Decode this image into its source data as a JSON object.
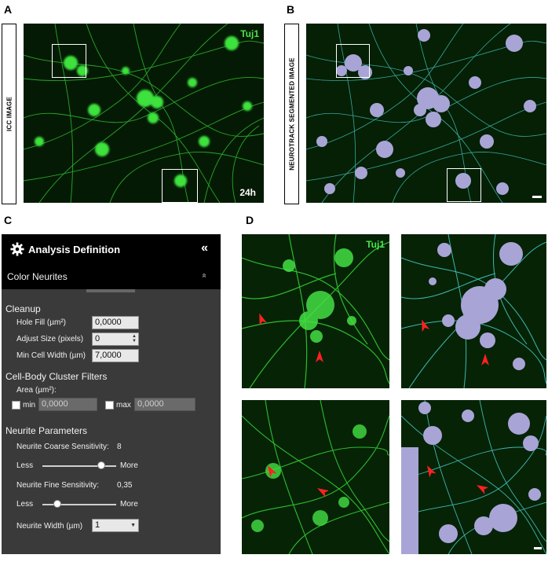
{
  "panels": {
    "a": {
      "letter": "A",
      "side_label": "ICC IMAGE",
      "stain": "Tuj1",
      "time": "24h"
    },
    "b": {
      "letter": "B",
      "side_label": "NEUROTRACK SEGMENTED IMAGE"
    },
    "c": {
      "letter": "C"
    },
    "d": {
      "letter": "D",
      "stain": "Tuj1"
    }
  },
  "analysis": {
    "title": "Analysis Definition",
    "collapse_icon": "«",
    "subtitle": "Color Neurites",
    "subtitle_chevron": "»",
    "cleanup": {
      "heading": "Cleanup",
      "hole_fill_label": "Hole Fill (µm²)",
      "hole_fill_value": "0,0000",
      "adjust_size_label": "Adjust Size (pixels)",
      "adjust_size_value": "0",
      "min_cell_width_label": "Min Cell Width (µm)",
      "min_cell_width_value": "7,0000"
    },
    "cluster": {
      "heading": "Cell-Body Cluster Filters",
      "area_label": "Area (µm²):",
      "min_label": "min",
      "min_value": "0,0000",
      "max_label": "max",
      "max_value": "0,0000"
    },
    "neurite": {
      "heading": "Neurite Parameters",
      "coarse_label": "Neurite Coarse Sensitivity:",
      "coarse_value": "8",
      "coarse_fraction": 0.8,
      "less": "Less",
      "more": "More",
      "fine_label": "Neurite Fine Sensitivity:",
      "fine_value": "0,35",
      "fine_fraction": 0.2,
      "width_label": "Neurite Width (µm)",
      "width_value": "1"
    }
  },
  "colors": {
    "stain_green": "#39d839",
    "segment_lavender": "#a9a4d6",
    "neurite_cyan": "#3fb6b0",
    "arrow_red": "#ff2020",
    "panel_dark": "#3a3a3a"
  }
}
